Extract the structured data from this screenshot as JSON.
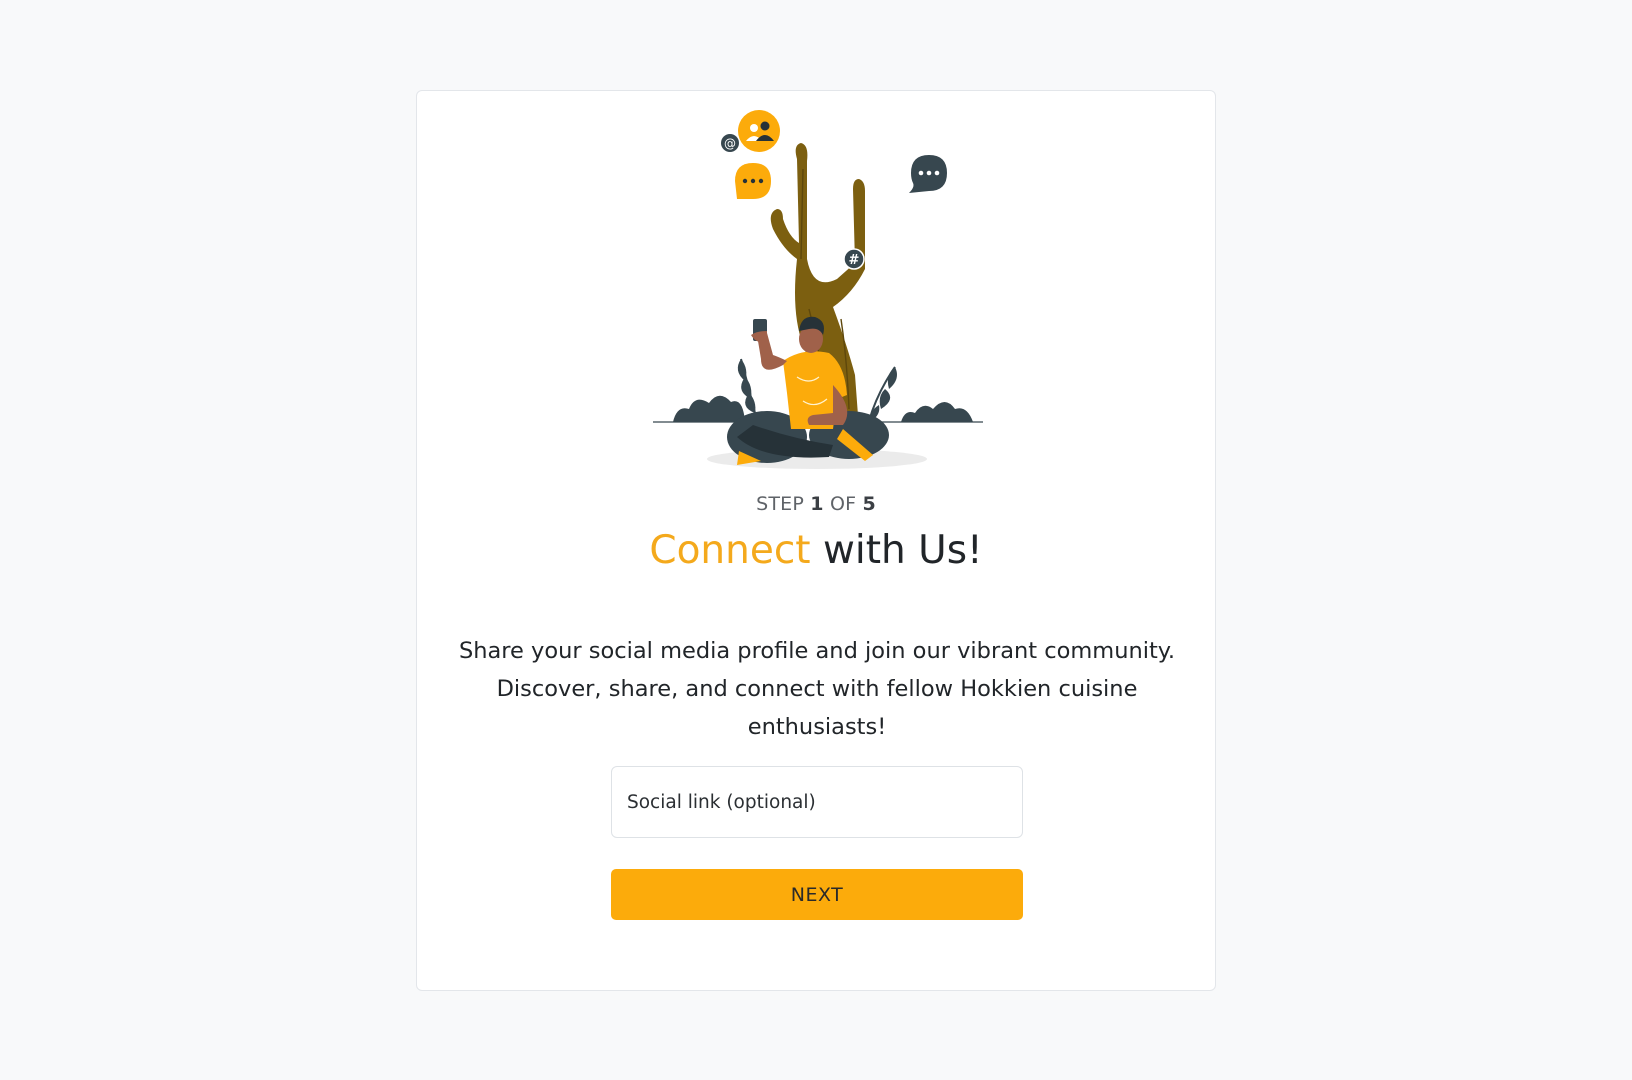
{
  "step": {
    "prefix": "STEP",
    "current": "1",
    "separator": "OF",
    "total": "5"
  },
  "title": {
    "accent": "Connect",
    "rest": " with Us!"
  },
  "description": "Share your social media profile and join our vibrant community. Discover, share, and connect with fellow Hokkien cuisine enthusiasts!",
  "social_input": {
    "placeholder": "Social link (optional)",
    "value": ""
  },
  "next_button": {
    "label": "NEXT"
  },
  "illustration": {
    "icons": [
      "user-group-icon",
      "at-sign-icon",
      "chat-bubble-icon",
      "hashtag-icon"
    ]
  },
  "colors": {
    "accent": "#f4a91c",
    "button": "#fcab0b",
    "background": "#f8f9fa",
    "dark": "#37474f"
  }
}
